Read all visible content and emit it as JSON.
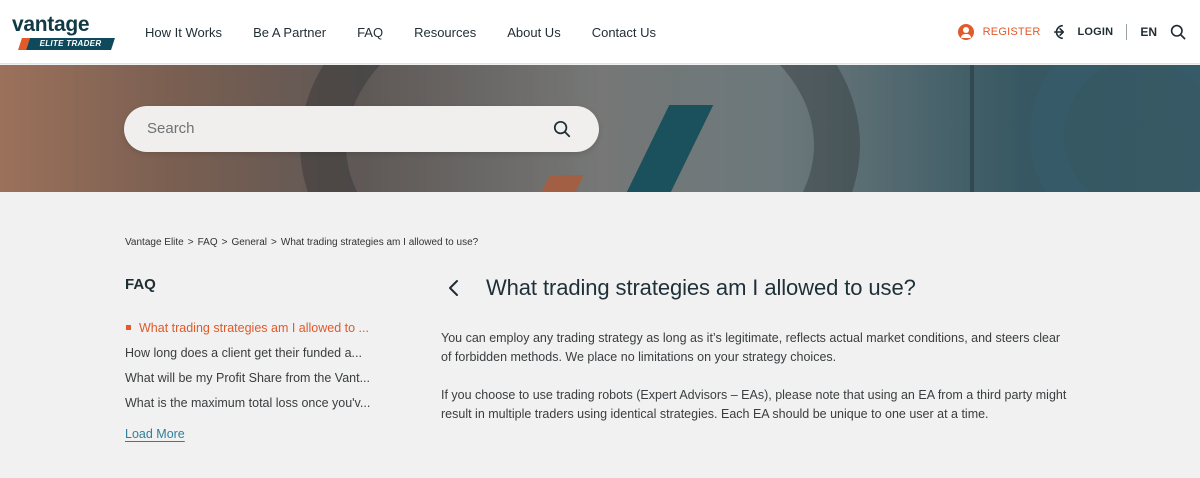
{
  "header": {
    "logo": {
      "word": "vantage",
      "badge": "ELITE TRADER"
    },
    "nav": [
      "How It Works",
      "Be A Partner",
      "FAQ",
      "Resources",
      "About Us",
      "Contact Us"
    ],
    "register_label": "REGISTER",
    "login_label": "LOGIN",
    "language": "EN"
  },
  "hero": {
    "search_placeholder": "Search"
  },
  "breadcrumb": [
    "Vantage Elite",
    "FAQ",
    "General",
    "What trading strategies am I allowed to use?"
  ],
  "breadcrumb_separator": ">",
  "sidebar": {
    "title": "FAQ",
    "items": [
      {
        "label": "What trading strategies am I allowed to ...",
        "active": true
      },
      {
        "label": "How long does a client get their funded a...",
        "active": false
      },
      {
        "label": "What will be my Profit Share from the Vant...",
        "active": false
      },
      {
        "label": "What is the maximum total loss once you'v...",
        "active": false
      }
    ],
    "load_more": "Load More"
  },
  "article": {
    "title": "What trading strategies am I allowed to use?",
    "paragraphs": [
      "You can employ any trading strategy as long as it’s legitimate, reflects actual market conditions, and steers clear of forbidden methods. We place no limitations on your strategy choices.",
      "If you choose to use trading robots (Expert Advisors – EAs), please note that using an EA from a third party might result in multiple traders using identical strategies. Each EA should be unique to one user at a time."
    ]
  },
  "colors": {
    "accent": "#e2592a",
    "brand_dark": "#123a45",
    "link": "#2f7f9a"
  },
  "icons": {
    "register": "user-circle-icon",
    "login": "login-arrow-icon",
    "search": "search-icon",
    "back": "chevron-left-icon"
  }
}
